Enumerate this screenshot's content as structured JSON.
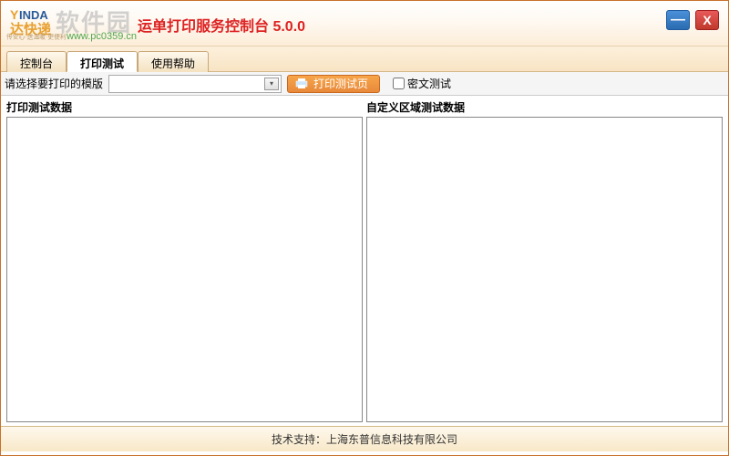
{
  "header": {
    "brand_main": "YUNDA",
    "brand_sub": "达快递",
    "brand_slogan": "传安心·送温暖·更便利",
    "app_title": "运单打印服务控制台 5.0.0",
    "watermark_text": "软件园",
    "watermark_url": "www.pc0359.cn"
  },
  "window_controls": {
    "minimize_symbol": "—",
    "close_symbol": "X"
  },
  "tabs": [
    {
      "label": "控制台",
      "active": false
    },
    {
      "label": "打印测试",
      "active": true
    },
    {
      "label": "使用帮助",
      "active": false
    }
  ],
  "toolbar": {
    "template_label": "请选择要打印的模版",
    "template_selected": "",
    "print_button_label": "打印测试页",
    "cipher_test_label": "密文测试",
    "cipher_test_checked": false
  },
  "panels": {
    "left_title": "打印测试数据",
    "right_title": "自定义区域测试数据"
  },
  "footer": {
    "support_label": "技术支持：",
    "support_company": "上海东普信息科技有限公司"
  }
}
